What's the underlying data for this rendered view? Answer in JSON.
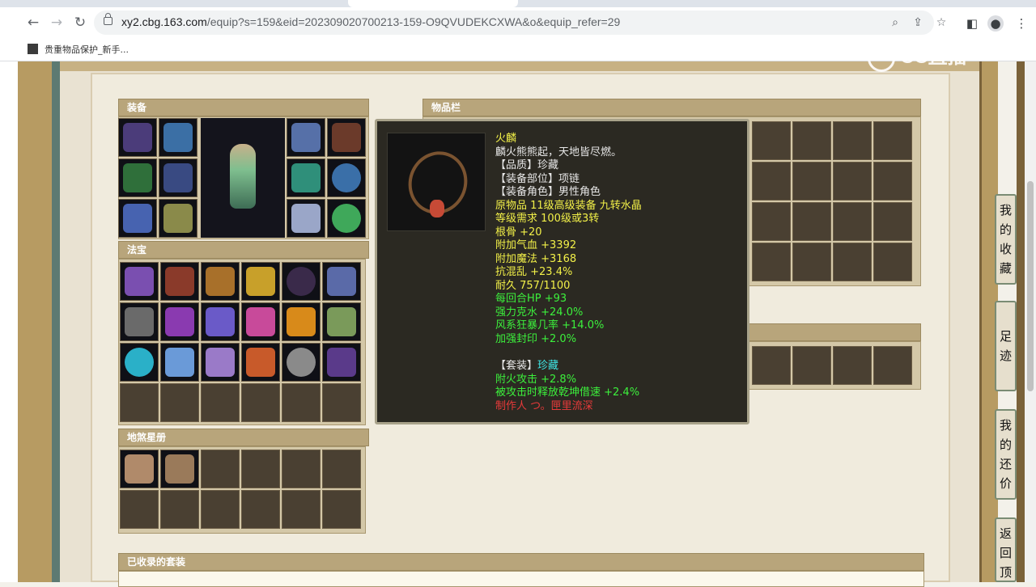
{
  "browser": {
    "url_host": "xy2.cbg.163.com",
    "url_path": "/equip?s=159&eid=202309020700213-159-O9QVUDEKCXWA&o&equip_refer=29",
    "bookmark_label": "贵重物品保护_新手..."
  },
  "watermark": {
    "text": "CC直播"
  },
  "panels": {
    "equip": "装备",
    "fabao": "法宝",
    "star": "地煞星册",
    "inventory": "物品栏",
    "collected": "已收录的套装"
  },
  "tooltip": {
    "name": "火麟",
    "desc": "麟火熊熊起，天地皆尽燃。",
    "quality": "【品质】珍藏",
    "slot": "【装备部位】项链",
    "role": "【装备角色】男性角色",
    "origin": "原物品 11级高级装备 九转水晶",
    "level": "等级需求 100级或3转",
    "stats": [
      "根骨 +20",
      "附加气血 +3392",
      "附加魔法 +3168",
      "抗混乱 +23.4%",
      "耐久 757/1100",
      "每回合HP +93",
      "强力克水 +24.0%",
      "风系狂暴几率 +14.0%",
      "加强封印 +2.0%"
    ],
    "set_label": "【套装】",
    "set_value": "珍藏",
    "set_effects": [
      "附火攻击 +2.8%",
      "被攻击时释放乾坤借速 +2.4%"
    ],
    "maker": "制作人 つ。匣里流深"
  },
  "side_tabs": {
    "favorites": "我的收藏",
    "history": "足迹",
    "my_bids": "我的还价",
    "back_top": "返回顶"
  },
  "colors": {
    "panel_header": "#b8a57b",
    "slot_bg": "#4a4032",
    "tooltip_bg": "#2b2922",
    "tooltip_yellow": "#f2f048",
    "tooltip_green": "#3cf03c",
    "tooltip_red": "#e83a3a"
  }
}
